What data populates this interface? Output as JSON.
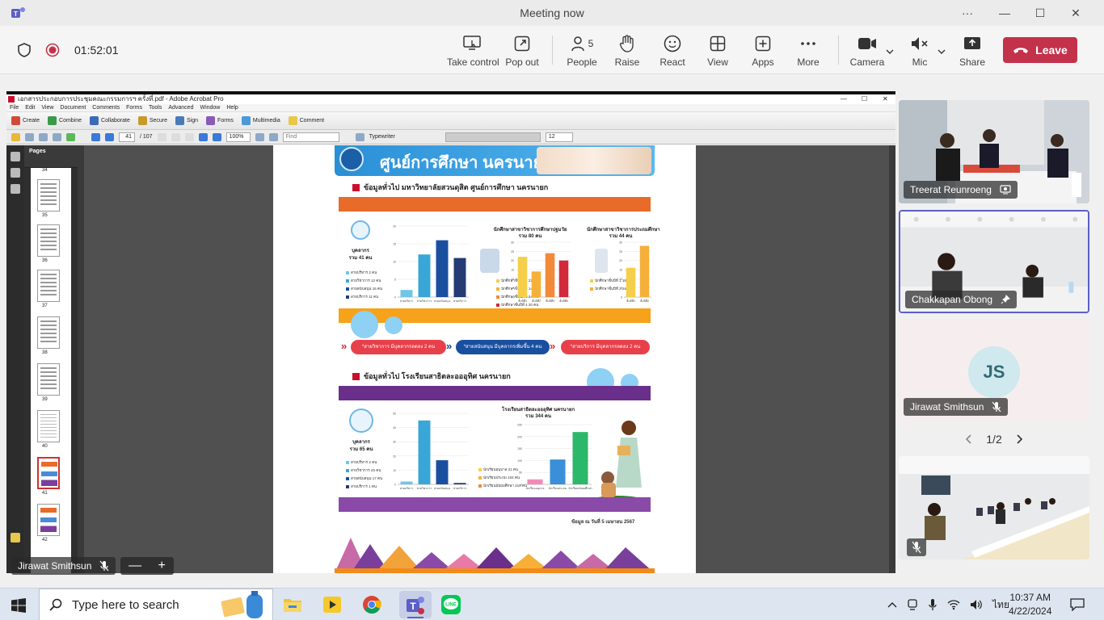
{
  "window": {
    "title": "Meeting now",
    "controls": {
      "more": "···",
      "minimize": "—",
      "maximize": "☐",
      "close": "✕"
    }
  },
  "toolbar": {
    "timer": "01:52:01",
    "buttons": [
      {
        "id": "take-control",
        "label": "Take control",
        "icon": "screen-cursor-icon"
      },
      {
        "id": "pop-out",
        "label": "Pop out",
        "icon": "pop-out-icon"
      },
      {
        "id": "people",
        "label": "People",
        "icon": "people-icon",
        "count": "5"
      },
      {
        "id": "raise",
        "label": "Raise",
        "icon": "hand-icon"
      },
      {
        "id": "react",
        "label": "React",
        "icon": "smiley-icon"
      },
      {
        "id": "view",
        "label": "View",
        "icon": "grid-icon"
      },
      {
        "id": "apps",
        "label": "Apps",
        "icon": "plus-box-icon"
      },
      {
        "id": "more",
        "label": "More",
        "icon": "ellipsis-icon"
      },
      {
        "id": "camera",
        "label": "Camera",
        "icon": "camera-icon"
      },
      {
        "id": "mic",
        "label": "Mic",
        "icon": "mic-muted-icon"
      },
      {
        "id": "share",
        "label": "Share",
        "icon": "share-icon"
      }
    ],
    "leave_label": "Leave"
  },
  "acrobat": {
    "title": "เอกสารประกอบการประชุมคณะกรรมการฯ ครั้งที่.pdf - Adobe Acrobat Pro",
    "menu": [
      "File",
      "Edit",
      "View",
      "Document",
      "Comments",
      "Forms",
      "Tools",
      "Advanced",
      "Window",
      "Help"
    ],
    "tasks": [
      "Create",
      "Combine",
      "Collaborate",
      "Secure",
      "Sign",
      "Forms",
      "Multimedia",
      "Comment"
    ],
    "page_current": "41",
    "page_total": "/ 107",
    "zoom": "100%",
    "find_placeholder": "Find",
    "typewriter": "Typewriter",
    "font_size": "12",
    "pages_panel_title": "Pages",
    "thumb_numbers": [
      "34",
      "35",
      "36",
      "37",
      "38",
      "39",
      "40",
      "41",
      "42"
    ]
  },
  "pdf": {
    "banner_title": "ศูนย์การศึกษา นครนายก",
    "section1_title": "ข้อมูลทั่วไป มหาวิทยาลัยสวนดุสิต ศูนย์การศึกษา นครนายก",
    "section2_title": "ข้อมูลทั่วไป โรงเรียนสาธิตละอออุทิศ นครนายก",
    "staff1_label": "บุคลากร",
    "staff1_total": "รวม 41 คน",
    "staff1_legend": [
      "สายบริหาร 2 คน",
      "สายวิชาการ 12 คน",
      "สายสนับสนุน 16 คน",
      "สายบริการ 11 คน"
    ],
    "students1_title": "นักศึกษาสาขาวิชาการศึกษาปฐมวัย",
    "students1_total": "รวม 80 คน",
    "students1_legend": [
      "นักศึกษาชั้นปีที่ 1 22 คน",
      "นักศึกษาชั้นปีที่ 2 14 คน",
      "นักศึกษาชั้นปีที่ 3 24 คน",
      "นักศึกษาชั้นปีที่ 4 20 คน"
    ],
    "students2_title": "นักศึกษาสาขาวิชาการประถมศึกษา",
    "students2_total": "รวม 44 คน",
    "students2_legend": [
      "นักศึกษาชั้นปีที่ 1 16 คน",
      "นักศึกษาชั้นปีที่ 2 28 คน"
    ],
    "pills": [
      "*สายวิชาการ มีบุคลากรลดลง 2 คน",
      "*สายสนับสนุน มีบุคลากรเพิ่มขึ้น 4 คน",
      "*สายบริการ มีบุคลากรลดลง 2 คน"
    ],
    "staff2_label": "บุคลากร",
    "staff2_total": "รวม 65 คน",
    "staff2_legend": [
      "สายบริหาร 2 คน",
      "สายวิชาการ 45 คน",
      "สายสนับสนุน 17 คน",
      "สายบริการ 1 คน"
    ],
    "school_title": "โรงเรียนสาธิตละอออุทิศ นครนายก",
    "school_total": "รวม 344 คน",
    "school_legend": [
      "นักเรียนอนุบาล 21 คน",
      "นักเรียนประถม 104 คน",
      "นักเรียนมัธยมศึกษา 219 คน"
    ],
    "footnote": "ข้อมูล ณ วันที่ 5 เมษายน 2567"
  },
  "chart_data": [
    {
      "type": "bar",
      "categories": [
        "สายบริหาร",
        "สายวิชาการ",
        "สายสนับสนุน",
        "สายบริการ"
      ],
      "values": [
        2,
        12,
        16,
        11
      ],
      "ylim": [
        0,
        20
      ],
      "yticks": [
        "0",
        "5",
        "10",
        "15",
        "20"
      ],
      "colors": [
        "#6fc6e6",
        "#3aa6d8",
        "#1a4fa0",
        "#243b74"
      ]
    },
    {
      "type": "bar",
      "categories": [
        "ชั้นปีที่1",
        "ชั้นปีที่2",
        "ชั้นปีที่3",
        "ชั้นปีที่4"
      ],
      "values": [
        22,
        14,
        24,
        20
      ],
      "ylim": [
        0,
        30
      ],
      "yticks": [
        "0",
        "5",
        "10",
        "15",
        "20",
        "25",
        "30"
      ],
      "colors": [
        "#f6cf4a",
        "#f6b03a",
        "#f28a3a",
        "#d22a3a"
      ]
    },
    {
      "type": "bar",
      "categories": [
        "ชั้นปีที่1",
        "ชั้นปีที่2"
      ],
      "values": [
        16,
        28
      ],
      "ylim": [
        0,
        30
      ],
      "yticks": [
        "0",
        "5",
        "10",
        "15",
        "20",
        "25",
        "30"
      ],
      "colors": [
        "#f6cf4a",
        "#f6b03a"
      ]
    },
    {
      "type": "bar",
      "categories": [
        "สายบริหาร",
        "สายวิชาการ",
        "สายสนับสนุน",
        "สายบริการ"
      ],
      "values": [
        2,
        45,
        17,
        1
      ],
      "ylim": [
        0,
        50
      ],
      "yticks": [
        "0",
        "10",
        "20",
        "30",
        "40",
        "50"
      ],
      "colors": [
        "#6fc6e6",
        "#3aa6d8",
        "#1a4fa0",
        "#243b74"
      ]
    },
    {
      "type": "bar",
      "categories": [
        "นักเรียนอนุบาล",
        "นักเรียนประถม",
        "นักเรียนมัธยมศึกษา"
      ],
      "values": [
        21,
        104,
        219
      ],
      "ylim": [
        0,
        250
      ],
      "yticks": [
        "0",
        "50",
        "100",
        "150",
        "200",
        "250"
      ],
      "colors": [
        "#f28ab8",
        "#3a8fd8",
        "#2cb86a"
      ]
    }
  ],
  "participants": [
    {
      "name": "Treerat Reunroeng"
    },
    {
      "name": "Chakkapan Obong"
    },
    {
      "name": "Jirawat Smithsun",
      "initials": "JS"
    }
  ],
  "presenter_tag": "Jirawat Smithsun",
  "zoom_controls": {
    "minus": "—",
    "plus": "+"
  },
  "pager": "1/2",
  "taskbar": {
    "search_placeholder": "Type here to search",
    "language": "ไทย",
    "time": "10:37 AM",
    "date": "4/22/2024"
  }
}
